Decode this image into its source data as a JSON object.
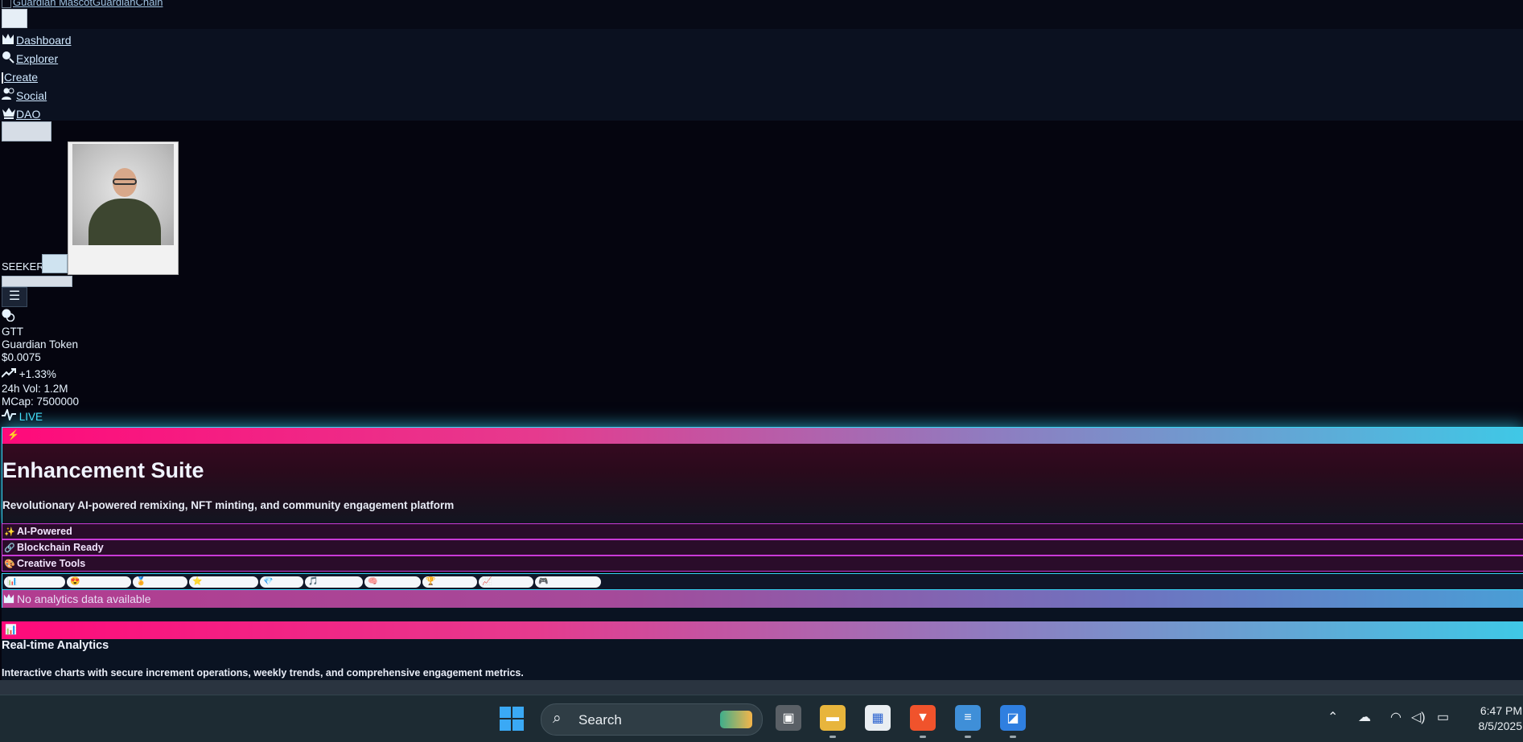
{
  "header": {
    "brand_text": "Guardian MascotGuardianChain"
  },
  "nav": {
    "items": [
      {
        "label": "Dashboard",
        "icon": "chart-icon"
      },
      {
        "label": "Explorer",
        "icon": "search-icon"
      },
      {
        "label": "Create",
        "icon": "plus-icon"
      },
      {
        "label": "Social",
        "icon": "users-icon"
      },
      {
        "label": "DAO",
        "icon": "crown-icon"
      }
    ]
  },
  "profile": {
    "role": "SEEKER"
  },
  "token": {
    "symbol": "GTT",
    "name": "Guardian Token",
    "price": "$0.0075",
    "change": "+1.33%",
    "volume": "24h Vol: 1.2M",
    "mcap": "MCap: 7500000",
    "status": "LIVE"
  },
  "suite": {
    "title": "Enhancement Suite",
    "subtitle": "Revolutionary AI-powered remixing, NFT minting, and community engagement platform",
    "features": [
      {
        "icon": "✨",
        "label": "AI-Powered"
      },
      {
        "icon": "🔗",
        "label": "Blockchain Ready"
      },
      {
        "icon": "🎨",
        "label": "Creative Tools"
      }
    ],
    "tabs": [
      {
        "icon": "📊"
      },
      {
        "icon": "😍"
      },
      {
        "icon": "🏅"
      },
      {
        "icon": "⭐"
      },
      {
        "icon": "💎"
      },
      {
        "icon": "🎵"
      },
      {
        "icon": "🧠"
      },
      {
        "icon": "🏆"
      },
      {
        "icon": "📈"
      },
      {
        "icon": "🎮"
      }
    ],
    "notice": "No analytics data available"
  },
  "analytics": {
    "icon": "📊",
    "title": "Real-time Analytics",
    "subtitle": "Interactive charts with secure increment operations, weekly trends, and comprehensive engagement metrics."
  },
  "taskbar": {
    "search_label": "Search",
    "time": "6:47 PM",
    "date": "8/5/2025"
  },
  "colors": {
    "accent_cyan": "#37d6f5",
    "accent_pink": "#ff0a7a",
    "background": "#05050f"
  }
}
